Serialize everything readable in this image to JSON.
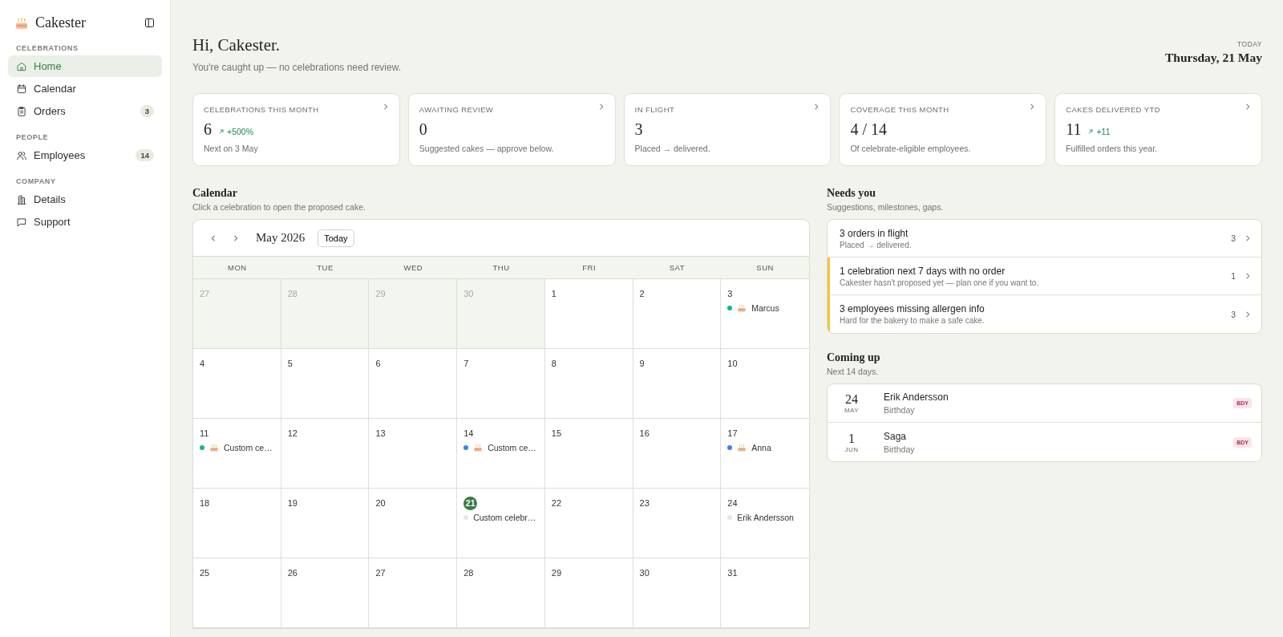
{
  "sidebar": {
    "brand": "Cakester",
    "sections": [
      {
        "label": "CELEBRATIONS",
        "items": [
          {
            "kind": "home",
            "label": "Home",
            "selected": true
          },
          {
            "kind": "calendar",
            "label": "Calendar",
            "selected": false
          },
          {
            "kind": "orders",
            "label": "Orders",
            "selected": false,
            "count": "3"
          }
        ]
      },
      {
        "label": "PEOPLE",
        "items": [
          {
            "kind": "employees",
            "label": "Employees",
            "selected": false,
            "count": "14"
          }
        ]
      },
      {
        "label": "COMPANY",
        "items": [
          {
            "kind": "details",
            "label": "Details",
            "selected": false
          },
          {
            "kind": "support",
            "label": "Support",
            "selected": false
          }
        ]
      }
    ]
  },
  "header": {
    "greeting": "Hi, Cakester.",
    "subtitle": "You're caught up — no celebrations need review.",
    "today_label": "TODAY",
    "today_date": "Thursday, 21 May"
  },
  "stats": [
    {
      "label": "CELEBRATIONS THIS MONTH",
      "value": "6",
      "delta": "+500%",
      "note": "Next on 3 May"
    },
    {
      "label": "AWAITING REVIEW",
      "value": "0",
      "note": "Suggested cakes — approve below."
    },
    {
      "label": "IN FLIGHT",
      "value": "3",
      "note": "Placed → delivered."
    },
    {
      "label": "COVERAGE THIS MONTH",
      "value": "4 / 14",
      "note": "Of celebrate-eligible employees."
    },
    {
      "label": "CAKES DELIVERED YTD",
      "value": "11",
      "delta": "+11",
      "note": "Fulfilled orders this year."
    }
  ],
  "calendar": {
    "title": "Calendar",
    "subtitle": "Click a celebration to open the proposed cake.",
    "month": "May 2026",
    "today_button": "Today",
    "weekdays": [
      "MON",
      "TUE",
      "WED",
      "THU",
      "FRI",
      "SAT",
      "SUN"
    ],
    "days": [
      {
        "day": "27",
        "outside": true,
        "today": false
      },
      {
        "day": "28",
        "outside": true,
        "today": false
      },
      {
        "day": "29",
        "outside": true,
        "today": false
      },
      {
        "day": "30",
        "outside": true,
        "today": false
      },
      {
        "day": "1",
        "outside": false,
        "today": false
      },
      {
        "day": "2",
        "outside": false,
        "today": false
      },
      {
        "day": "3",
        "outside": false,
        "today": false,
        "events": [
          {
            "kind": "cake",
            "color": "#10b981",
            "label": "Marcus"
          }
        ]
      },
      {
        "day": "4",
        "outside": false,
        "today": false
      },
      {
        "day": "5",
        "outside": false,
        "today": false
      },
      {
        "day": "6",
        "outside": false,
        "today": false
      },
      {
        "day": "7",
        "outside": false,
        "today": false
      },
      {
        "day": "8",
        "outside": false,
        "today": false
      },
      {
        "day": "9",
        "outside": false,
        "today": false
      },
      {
        "day": "10",
        "outside": false,
        "today": false
      },
      {
        "day": "11",
        "outside": false,
        "today": false,
        "events": [
          {
            "kind": "cake",
            "color": "#10b981",
            "label": "Custom ce…"
          }
        ]
      },
      {
        "day": "12",
        "outside": false,
        "today": false
      },
      {
        "day": "13",
        "outside": false,
        "today": false
      },
      {
        "day": "14",
        "outside": false,
        "today": false,
        "events": [
          {
            "kind": "cake",
            "color": "#3b82f6",
            "label": "Custom ce…"
          }
        ]
      },
      {
        "day": "15",
        "outside": false,
        "today": false
      },
      {
        "day": "16",
        "outside": false,
        "today": false
      },
      {
        "day": "17",
        "outside": false,
        "today": false,
        "events": [
          {
            "kind": "cake",
            "color": "#3b82f6",
            "label": "Anna"
          }
        ]
      },
      {
        "day": "18",
        "outside": false,
        "today": false
      },
      {
        "day": "19",
        "outside": false,
        "today": false
      },
      {
        "day": "20",
        "outside": false,
        "today": false
      },
      {
        "day": "21",
        "outside": false,
        "today": true,
        "events": [
          {
            "kind": "plain",
            "color": "#e5e7e1",
            "label": "Custom celebr…"
          }
        ]
      },
      {
        "day": "22",
        "outside": false,
        "today": false
      },
      {
        "day": "23",
        "outside": false,
        "today": false
      },
      {
        "day": "24",
        "outside": false,
        "today": false,
        "events": [
          {
            "kind": "plain",
            "color": "#e5e7e1",
            "label": "Erik Andersson"
          }
        ]
      },
      {
        "day": "25",
        "outside": false,
        "today": false
      },
      {
        "day": "26",
        "outside": false,
        "today": false
      },
      {
        "day": "27",
        "outside": false,
        "today": false
      },
      {
        "day": "28",
        "outside": false,
        "today": false
      },
      {
        "day": "29",
        "outside": false,
        "today": false
      },
      {
        "day": "30",
        "outside": false,
        "today": false
      },
      {
        "day": "31",
        "outside": false,
        "today": false
      }
    ]
  },
  "needs_you": {
    "title": "Needs you",
    "subtitle": "Suggestions, milestones, gaps.",
    "items": [
      {
        "title": "3 orders in flight",
        "note": "Placed → delivered.",
        "count": "3",
        "flagged": false
      },
      {
        "title": "1 celebration next 7 days with no order",
        "note": "Cakester hasn't proposed yet — plan one if you want to.",
        "count": "1",
        "flagged": true
      },
      {
        "title": "3 employees missing allergen info",
        "note": "Hard for the bakery to make a safe cake.",
        "count": "3",
        "flagged": true
      }
    ]
  },
  "coming_up": {
    "title": "Coming up",
    "subtitle": "Next 14 days.",
    "items": [
      {
        "day": "24",
        "month": "MAY",
        "name": "Erik Andersson",
        "type": "Birthday",
        "tag": "BDY"
      },
      {
        "day": "1",
        "month": "JUN",
        "name": "Saga",
        "type": "Birthday",
        "tag": "BDY"
      }
    ]
  }
}
